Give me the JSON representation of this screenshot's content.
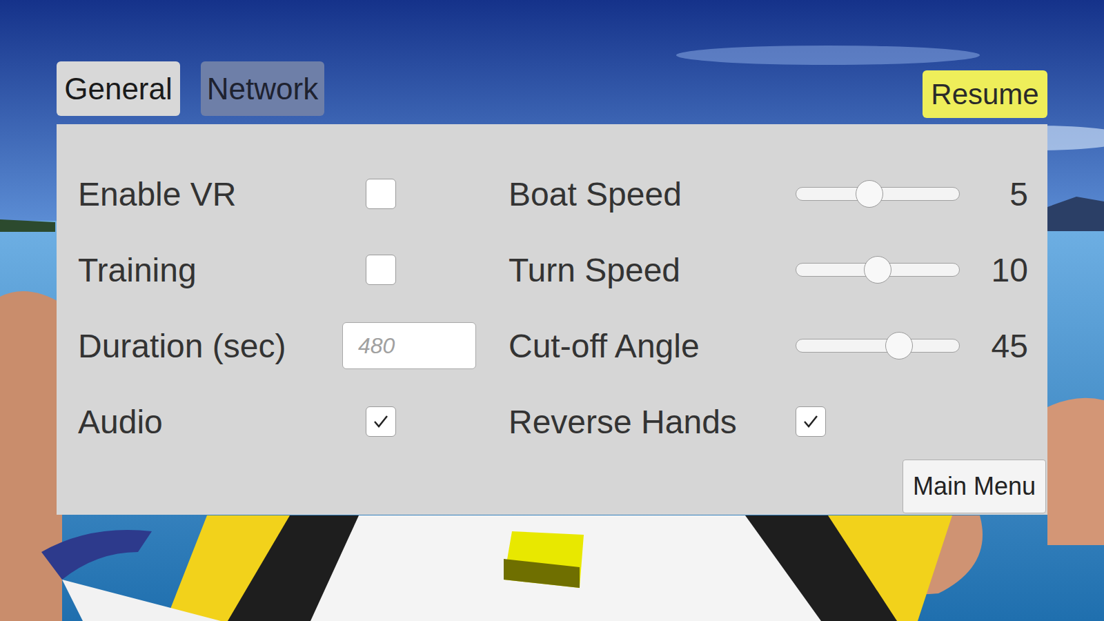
{
  "tabs": [
    {
      "label": "General",
      "selected": true
    },
    {
      "label": "Network",
      "selected": false
    }
  ],
  "resume_button": "Resume",
  "settings": {
    "left": [
      {
        "kind": "checkbox",
        "label": "Enable VR",
        "checked": false
      },
      {
        "kind": "checkbox",
        "label": "Training",
        "checked": false
      },
      {
        "kind": "field",
        "label": "Duration (sec)",
        "placeholder": "480"
      },
      {
        "kind": "checkbox",
        "label": "Audio",
        "checked": true
      }
    ],
    "right": [
      {
        "kind": "slider",
        "label": "Boat Speed",
        "level": 0.45,
        "reading": "5"
      },
      {
        "kind": "slider",
        "label": "Turn Speed",
        "level": 0.5,
        "reading": "10"
      },
      {
        "kind": "slider",
        "label": "Cut-off Angle",
        "level": 0.63,
        "reading": "45"
      },
      {
        "kind": "checkbox",
        "label": "Reverse Hands",
        "checked": true
      }
    ]
  },
  "main_menu_button": "Main Menu"
}
